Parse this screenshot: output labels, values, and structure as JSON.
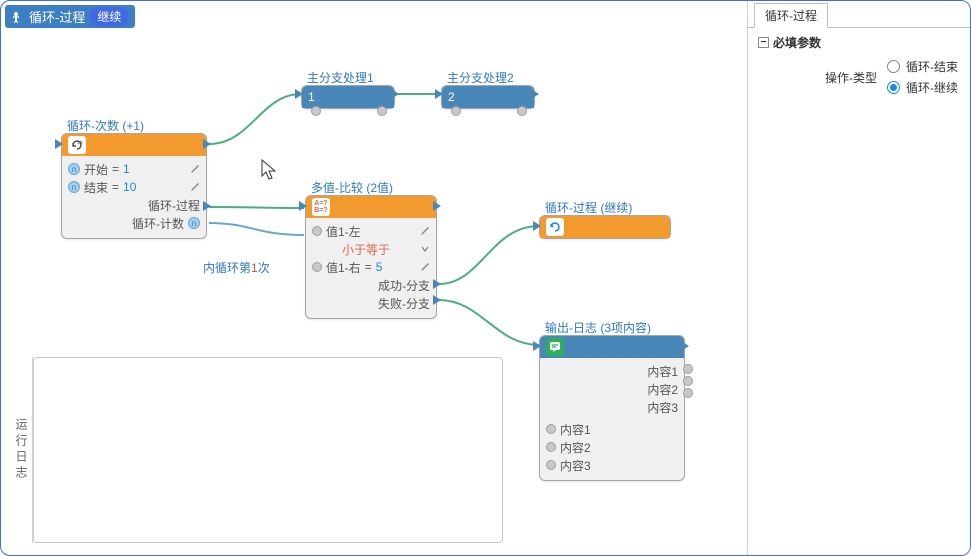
{
  "header": {
    "title": "循环-过程",
    "badge": "继续"
  },
  "sidebar": {
    "tab": "循环-过程",
    "section": "必填参数",
    "param_label": "操作-类型",
    "options": [
      {
        "label": "循环-结束",
        "selected": false
      },
      {
        "label": "循环-继续",
        "selected": true
      }
    ]
  },
  "log": {
    "label": "运行日志"
  },
  "nodes": {
    "main1": {
      "title": "主分支处理1",
      "value": "1"
    },
    "main2": {
      "title": "主分支处理2",
      "value": "2"
    },
    "loopCount": {
      "title": "循环-次数 (+1)",
      "startLabel": "开始",
      "startVal": "1",
      "endLabel": "结束",
      "endVal": "10",
      "procLabel": "循环-过程",
      "countLabel": "循环-计数"
    },
    "innerLoopLabel": "内循环第",
    "innerLoopTimes": "1",
    "innerLoopSuffix": "次",
    "compare": {
      "title": "多值-比较 (2值)",
      "v1Label": "值1-左",
      "opLabel": "小于等于",
      "v2Label": "值1-右",
      "v2Val": "5",
      "succLabel": "成功-分支",
      "failLabel": "失败-分支"
    },
    "continueNode": {
      "title": "循环-过程 (继续)"
    },
    "logNode": {
      "title": "输出-日志 (3项内容)",
      "itemsRight": [
        "内容1",
        "内容2",
        "内容3"
      ],
      "itemsLeft": [
        "内容1",
        "内容2",
        "内容3"
      ]
    }
  }
}
